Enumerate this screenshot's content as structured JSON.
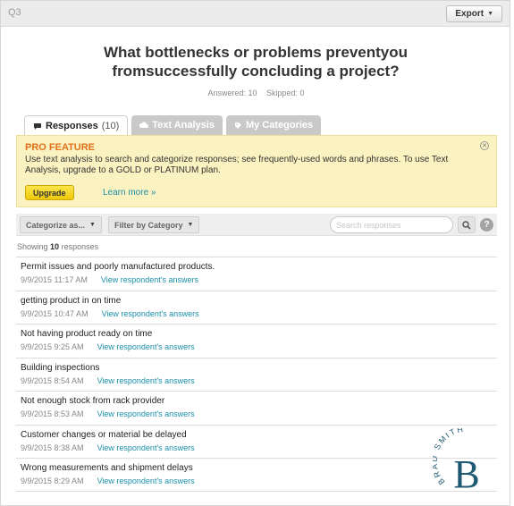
{
  "header": {
    "question_number": "Q3",
    "export_label": "Export"
  },
  "question": {
    "title": "What bottlenecks or problems preventyou fromsuccessfully concluding a project?",
    "answered": "Answered: 10",
    "skipped": "Skipped: 0"
  },
  "tabs": [
    {
      "label": "Responses",
      "count": "(10)",
      "icon": "speech-bubble-icon"
    },
    {
      "label": "Text Analysis",
      "icon": "cloud-icon"
    },
    {
      "label": "My Categories",
      "icon": "tag-icon"
    }
  ],
  "pro": {
    "title": "PRO FEATURE",
    "text": "Use text analysis to search and categorize responses; see frequently-used words and phrases. To use Text Analysis, upgrade to a GOLD or PLATINUM plan.",
    "upgrade_label": "Upgrade",
    "learn_more": "Learn more »"
  },
  "filters": {
    "categorize_label": "Categorize as...",
    "filter_label": "Filter by Category",
    "search_placeholder": "Search responses"
  },
  "showing": {
    "prefix": "Showing",
    "count": "10",
    "suffix": "responses"
  },
  "responses": [
    {
      "text": "Permit issues and poorly manufactured products.",
      "date": "9/9/2015 11:17 AM",
      "link": "View respondent's answers"
    },
    {
      "text": "getting product in on time",
      "date": "9/9/2015 10:47 AM",
      "link": "View respondent's answers"
    },
    {
      "text": "Not having product ready on time",
      "date": "9/9/2015 9:25 AM",
      "link": "View respondent's answers"
    },
    {
      "text": "Building inspections",
      "date": "9/9/2015 8:54 AM",
      "link": "View respondent's answers"
    },
    {
      "text": "Not enough stock from rack provider",
      "date": "9/9/2015 8:53 AM",
      "link": "View respondent's answers"
    },
    {
      "text": "Customer changes or material be delayed",
      "date": "9/9/2015 8:38 AM",
      "link": "View respondent's answers"
    },
    {
      "text": "Wrong measurements and shipment delays",
      "date": "9/9/2015 8:29 AM",
      "link": "View respondent's answers"
    }
  ],
  "watermark": {
    "name": "BRAD SMITH",
    "initial": "B",
    "color": "#1f5a72"
  },
  "colors": {
    "accent_link": "#1a8fa8",
    "pro_title": "#e0701a",
    "pro_bg": "#fbf2c1",
    "upgrade": "#f5d61e"
  }
}
